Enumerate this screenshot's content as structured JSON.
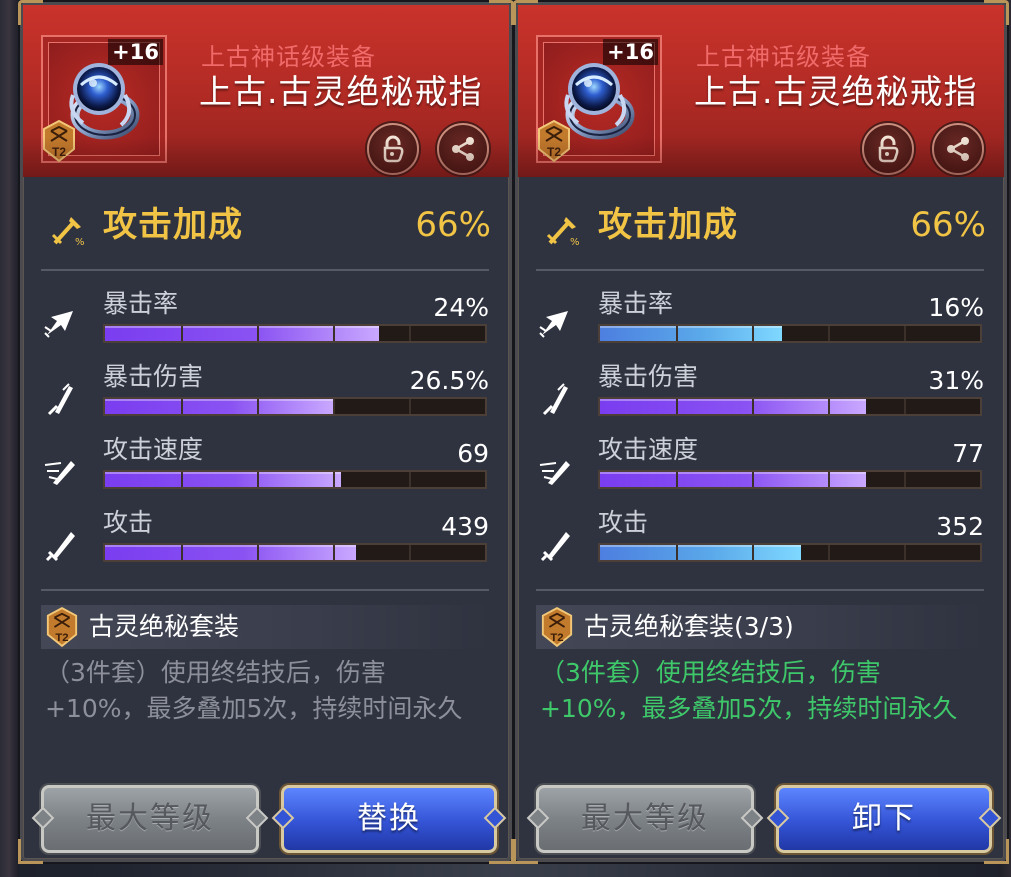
{
  "colors": {
    "header_red": "#b02a24",
    "gold_text": "#f1c445",
    "rarity_red": "#f06a6a",
    "set_active_green": "#3ec86a",
    "bar_purple": "#8a52f2",
    "bar_blue": "#5aa8e9"
  },
  "panels": [
    {
      "item": {
        "level": "+16",
        "tier": "T2",
        "rarity": "上古神话级装备",
        "name": "上古.古灵绝秘戒指",
        "icon": "ring-icon"
      },
      "main_stat": {
        "label": "攻击加成",
        "value": "66%"
      },
      "stats": [
        {
          "label": "暴击率",
          "value": "24%",
          "fill": 0.72,
          "color": "purple",
          "icon": "crit-rate-icon"
        },
        {
          "label": "暴击伤害",
          "value": "26.5%",
          "fill": 0.6,
          "color": "purple",
          "icon": "crit-damage-icon"
        },
        {
          "label": "攻击速度",
          "value": "69",
          "fill": 0.62,
          "color": "purple",
          "icon": "attack-speed-icon"
        },
        {
          "label": "攻击",
          "value": "439",
          "fill": 0.66,
          "color": "purple",
          "icon": "attack-icon"
        }
      ],
      "set": {
        "name": "古灵绝秘套装",
        "desc": "（3件套）使用终结技后，伤害+10%，最多叠加5次，持续时间永久",
        "active": false
      },
      "buttons": {
        "max_level": "最大等级",
        "primary": "替换"
      }
    },
    {
      "item": {
        "level": "+16",
        "tier": "T2",
        "rarity": "上古神话级装备",
        "name": "上古.古灵绝秘戒指",
        "icon": "ring-icon"
      },
      "main_stat": {
        "label": "攻击加成",
        "value": "66%"
      },
      "stats": [
        {
          "label": "暴击率",
          "value": "16%",
          "fill": 0.48,
          "color": "blue",
          "icon": "crit-rate-icon"
        },
        {
          "label": "暴击伤害",
          "value": "31%",
          "fill": 0.7,
          "color": "purple",
          "icon": "crit-damage-icon"
        },
        {
          "label": "攻击速度",
          "value": "77",
          "fill": 0.7,
          "color": "purple",
          "icon": "attack-speed-icon"
        },
        {
          "label": "攻击",
          "value": "352",
          "fill": 0.53,
          "color": "blue",
          "icon": "attack-icon"
        }
      ],
      "set": {
        "name": "古灵绝秘套装(3/3)",
        "desc": "（3件套）使用终结技后，伤害+10%，最多叠加5次，持续时间永久",
        "active": true
      },
      "buttons": {
        "max_level": "最大等级",
        "primary": "卸下"
      }
    }
  ]
}
